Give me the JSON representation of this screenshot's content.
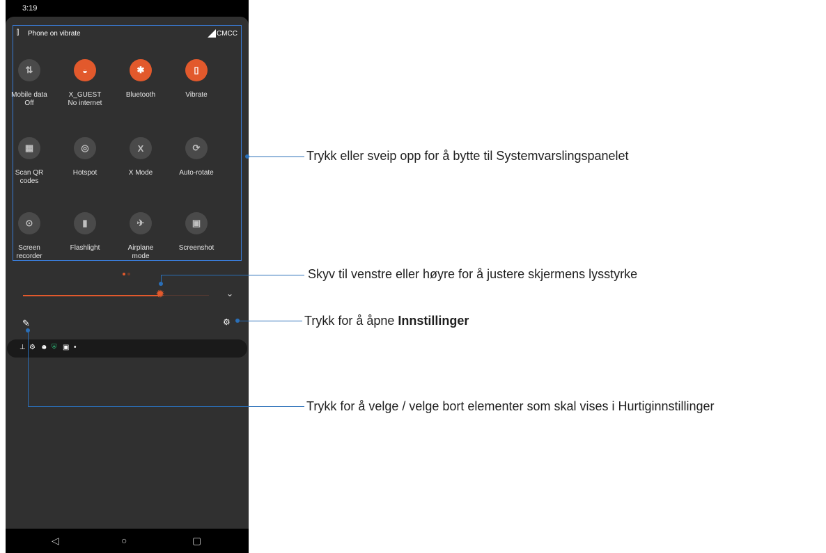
{
  "status": {
    "time": "3:19"
  },
  "quick_settings": {
    "header": {
      "ringer_icon": "vibrate-icon",
      "ringer_label": "Phone on vibrate",
      "network_icon": "signal-icon",
      "carrier": "CMCC"
    },
    "tiles": [
      {
        "icon": "data-arrows-icon",
        "glyph": "⇅",
        "state": "off",
        "label": "Mobile data\nOff"
      },
      {
        "icon": "wifi-off-icon",
        "glyph": "◒",
        "state": "on",
        "label": "X_GUEST\nNo internet"
      },
      {
        "icon": "bluetooth-icon",
        "glyph": "✱",
        "state": "on",
        "label": "Bluetooth"
      },
      {
        "icon": "vibrate-icon",
        "glyph": "▯",
        "state": "on",
        "label": "Vibrate"
      },
      {
        "icon": "qr-code-icon",
        "glyph": "▦",
        "state": "off",
        "label": "Scan QR\ncodes"
      },
      {
        "icon": "hotspot-icon",
        "glyph": "◎",
        "state": "off",
        "label": "Hotspot"
      },
      {
        "icon": "x-mode-icon",
        "glyph": "X",
        "state": "off",
        "label": "X Mode"
      },
      {
        "icon": "auto-rotate-icon",
        "glyph": "⟳",
        "state": "off",
        "label": "Auto-rotate"
      },
      {
        "icon": "screen-recorder-icon",
        "glyph": "⊙",
        "state": "off",
        "label": "Screen\nrecorder"
      },
      {
        "icon": "flashlight-icon",
        "glyph": "▮",
        "state": "off",
        "label": "Flashlight"
      },
      {
        "icon": "airplane-icon",
        "glyph": "✈",
        "state": "off",
        "label": "Airplane\nmode"
      },
      {
        "icon": "screenshot-icon",
        "glyph": "▣",
        "state": "off",
        "label": "Screenshot"
      }
    ],
    "page_dots": 2,
    "active_page": 1
  },
  "brightness": {
    "level": 0.75,
    "thumb_icon": "brightness-icon",
    "expand_icon": "chevron-down-icon"
  },
  "edit": {
    "icon": "pencil-icon"
  },
  "settings": {
    "icon": "gear-icon"
  },
  "notification_icons": [
    "pin-icon",
    "gear-icon",
    "user-icon",
    "shield-icon",
    "image-icon",
    "dot-icon"
  ],
  "nav": {
    "back_icon": "back-icon",
    "home_icon": "home-icon",
    "recents_icon": "recents-icon"
  },
  "callouts": {
    "panel_switch": "Trykk eller sveip opp for å bytte til Systemvarslingspanelet",
    "brightness": "Skyv til venstre eller høyre for å justere skjermens lysstyrke",
    "settings_prefix": "Trykk for å åpne ",
    "settings_bold": "Innstillinger",
    "edit": "Trykk for å velge / velge bort elementer som skal vises i Hurtiginnstillinger"
  },
  "colors": {
    "accent": "#e2592c",
    "callout_line": "#2a6fb8",
    "panel_bg": "#303030",
    "tile_off": "#4a4a4a"
  }
}
